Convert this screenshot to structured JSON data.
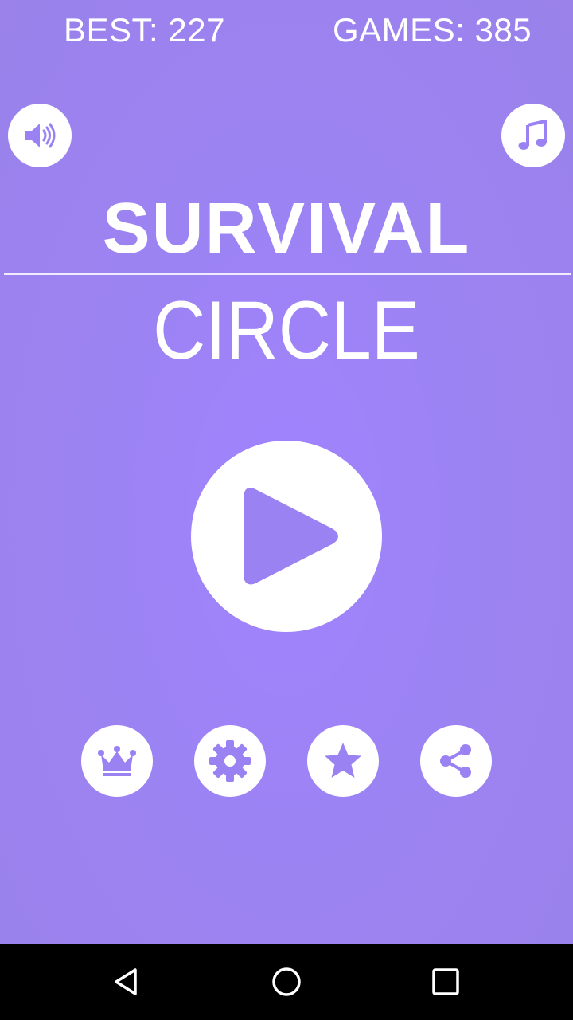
{
  "stats": {
    "best_text": "BEST: 227",
    "games_text": "GAMES: 385"
  },
  "title": {
    "line1": "SURVIVAL",
    "line2": "CIRCLE"
  },
  "buttons": {
    "sound": "speaker-icon",
    "music": "music-note-icon",
    "play": "play-icon",
    "leaderboard": "crown-icon",
    "settings": "gear-icon",
    "rate": "star-icon",
    "share": "share-icon"
  },
  "navigation": {
    "back": "back-triangle-icon",
    "home": "home-circle-icon",
    "recents": "recents-square-icon"
  },
  "colors": {
    "background": "#9d84f5",
    "icon": "#9b82f2",
    "foreground": "#ffffff",
    "navbar": "#000000"
  }
}
